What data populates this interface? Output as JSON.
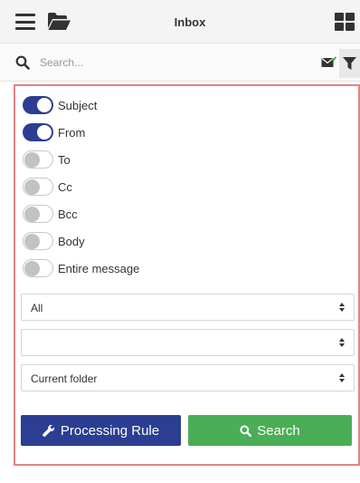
{
  "header": {
    "title": "Inbox",
    "icons": [
      "menu-icon",
      "folder-open-icon",
      "grid-icon"
    ]
  },
  "search": {
    "placeholder": "Search...",
    "value": "",
    "icons": [
      "search-icon",
      "mail-check-icon",
      "filter-icon"
    ]
  },
  "filters": {
    "toggles": [
      {
        "label": "Subject",
        "on": true
      },
      {
        "label": "From",
        "on": true
      },
      {
        "label": "To",
        "on": false
      },
      {
        "label": "Cc",
        "on": false
      },
      {
        "label": "Bcc",
        "on": false
      },
      {
        "label": "Body",
        "on": false
      },
      {
        "label": "Entire message",
        "on": false
      }
    ],
    "selects": [
      {
        "value": ""
      },
      {
        "value": "All"
      },
      {
        "value": "Current folder"
      }
    ]
  },
  "buttons": {
    "processing_rule": "Processing Rule",
    "search": "Search"
  },
  "colors": {
    "accent_blue": "#2c3e92",
    "search_green": "#4aae56",
    "panel_border": "#e38484"
  }
}
